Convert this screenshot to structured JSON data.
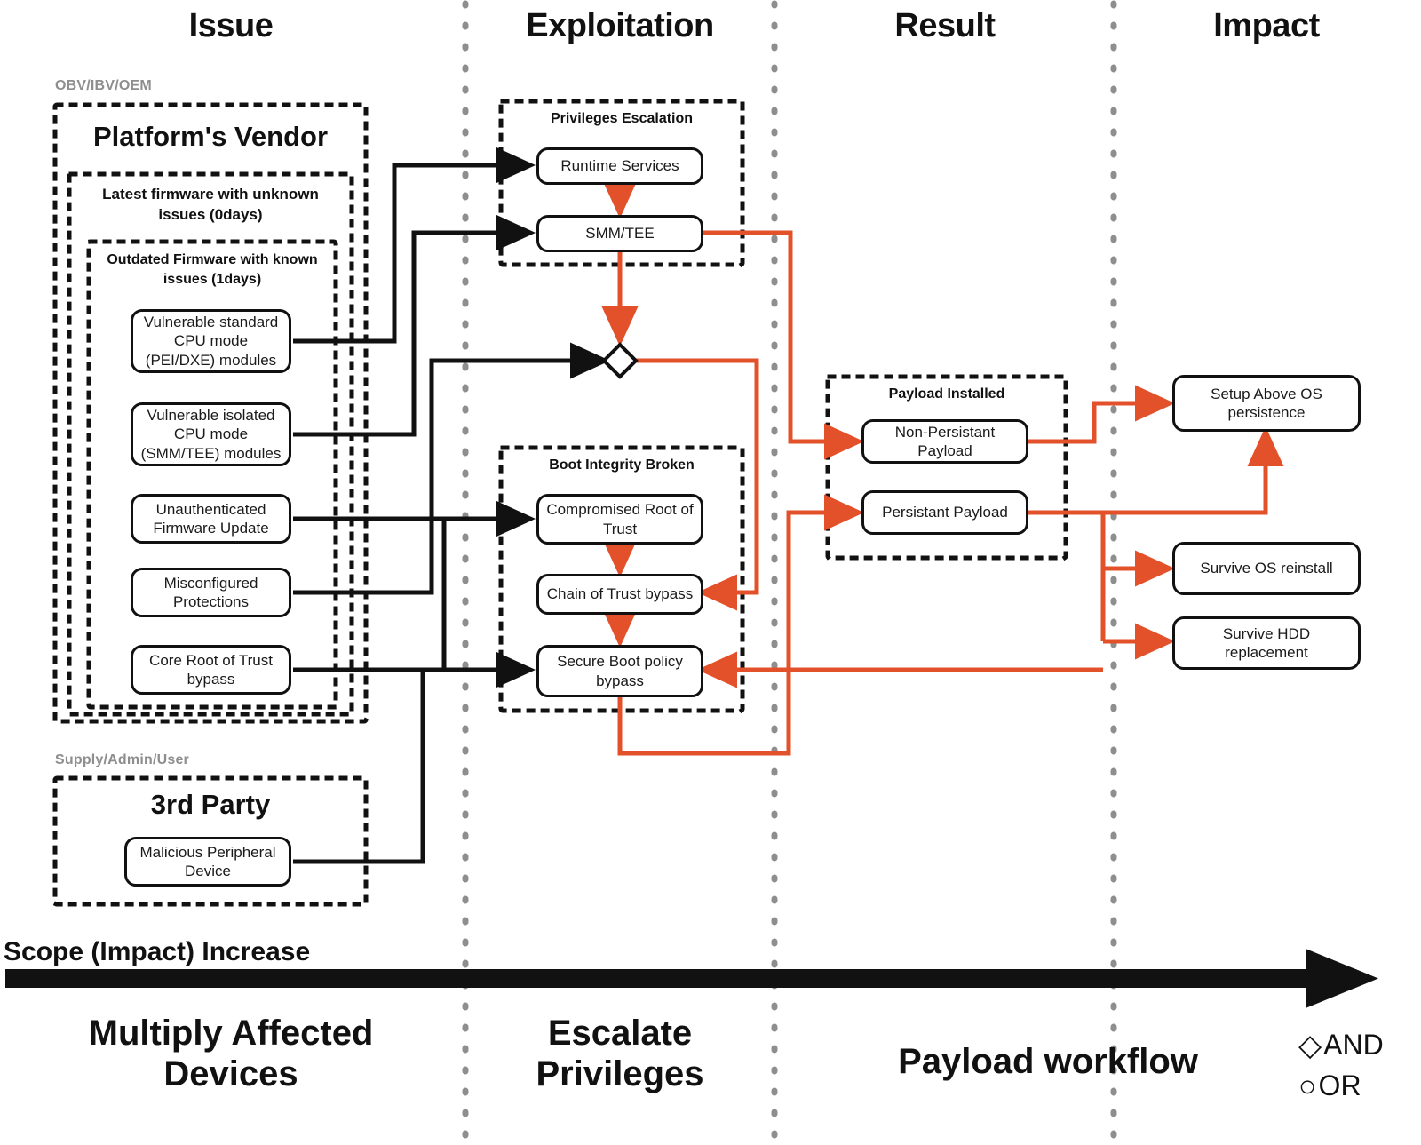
{
  "columns": [
    {
      "id": "issue",
      "label": "Issue"
    },
    {
      "id": "exploitation",
      "label": "Exploitation"
    },
    {
      "id": "result",
      "label": "Result"
    },
    {
      "id": "impact",
      "label": "Impact"
    }
  ],
  "groups": {
    "obv_tag": "OBV/IBV/OEM",
    "platform_vendor": "Platform's Vendor",
    "latest_firmware": "Latest firmware with unknown issues (0days)",
    "outdated_firmware": "Outdated Firmware with known issues (1days)",
    "supply_tag": "Supply/Admin/User",
    "third_party": "3rd Party",
    "privileges_escalation": "Privileges Escalation",
    "boot_integrity_broken": "Boot Integrity Broken",
    "payload_installed": "Payload Installed"
  },
  "nodes": {
    "vuln_standard_cpu": "Vulnerable standard CPU mode (PEI/DXE) modules",
    "vuln_isolated_cpu": "Vulnerable isolated CPU mode (SMM/TEE) modules",
    "unauth_fw_update": "Unauthenticated Firmware Update",
    "misconfigured_protections": "Misconfigured Protections",
    "core_root_bypass": "Core Root of Trust bypass",
    "malicious_peripheral": "Malicious Peripheral Device",
    "runtime_services": "Runtime Services",
    "smm_tee": "SMM/TEE",
    "compromised_root": "Compromised Root of Trust",
    "chain_of_trust_bypass": "Chain of Trust bypass",
    "secure_boot_bypass": "Secure Boot policy bypass",
    "non_persistant_payload": "Non-Persistant Payload",
    "persistant_payload": "Persistant Payload",
    "setup_above_os": "Setup Above OS persistence",
    "survive_os_reinstall": "Survive OS reinstall",
    "survive_hdd_replacement": "Survive HDD replacement"
  },
  "axis": {
    "scope_label": "Scope (Impact) Increase"
  },
  "bottom_labels": [
    {
      "id": "multiply-affected-devices",
      "text": "Multiply Affected Devices"
    },
    {
      "id": "escalate-privileges",
      "text": "Escalate Privileges"
    },
    {
      "id": "payload-workflow",
      "text": "Payload workflow"
    }
  ],
  "legend": [
    {
      "id": "and",
      "glyph": "◇",
      "text": "AND"
    },
    {
      "id": "or",
      "glyph": "○",
      "text": "OR"
    }
  ],
  "colors": {
    "black": "#111111",
    "red": "#E3512B",
    "grey_divider": "#8e8e8e",
    "grey_tag": "#8e8e8e"
  }
}
